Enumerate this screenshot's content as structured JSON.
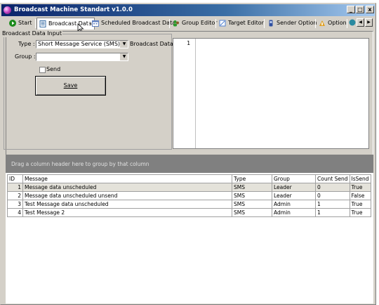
{
  "window": {
    "title": "Broadcast Machine Standart v1.0.0"
  },
  "caption_buttons": [
    "_",
    "□",
    "x"
  ],
  "tabs": [
    {
      "label": "Start",
      "icon": "play-icon",
      "color": "#1a8a1a"
    },
    {
      "label": "Broadcast Data",
      "icon": "document-icon",
      "color": "#3a6ea5"
    },
    {
      "label": "Scheduled Broadcast Data",
      "icon": "calendar-icon",
      "color": "#6080c0"
    },
    {
      "label": "Group Editor",
      "icon": "group-icon",
      "color": "#2a9a2a"
    },
    {
      "label": "Target Editor",
      "icon": "target-icon",
      "color": "#5080d0"
    },
    {
      "label": "Sender Option",
      "icon": "phone-icon",
      "color": "#3050a0"
    },
    {
      "label": "Option",
      "icon": "option-icon",
      "color": "#e0a020"
    }
  ],
  "form": {
    "groupbox_label": "Broadcast Data Input",
    "type_label": "Type :",
    "type_value": "Short Message Service (SMS)",
    "group_label": "Group :",
    "group_value": "",
    "send_label": "Send",
    "save_label": "Save",
    "broadcast_data_label": "Broadcast Data :",
    "line_number": "1"
  },
  "grid": {
    "group_panel_hint": "Drag a column header here to group by that column",
    "columns": [
      "ID",
      "Message",
      "Type",
      "Group",
      "Count Send",
      "IsSend"
    ],
    "rows": [
      {
        "id": "1",
        "message": "Message data unscheduled",
        "type": "SMS",
        "group": "Leader",
        "count_send": "0",
        "is_send": "True"
      },
      {
        "id": "2",
        "message": "Message data unscheduled unsend",
        "type": "SMS",
        "group": "Leader",
        "count_send": "0",
        "is_send": "False"
      },
      {
        "id": "3",
        "message": "Test Message data unscheduled",
        "type": "SMS",
        "group": "Admin",
        "count_send": "1",
        "is_send": "True"
      },
      {
        "id": "4",
        "message": "Test Message 2",
        "type": "SMS",
        "group": "Admin",
        "count_send": "1",
        "is_send": "True"
      }
    ]
  }
}
